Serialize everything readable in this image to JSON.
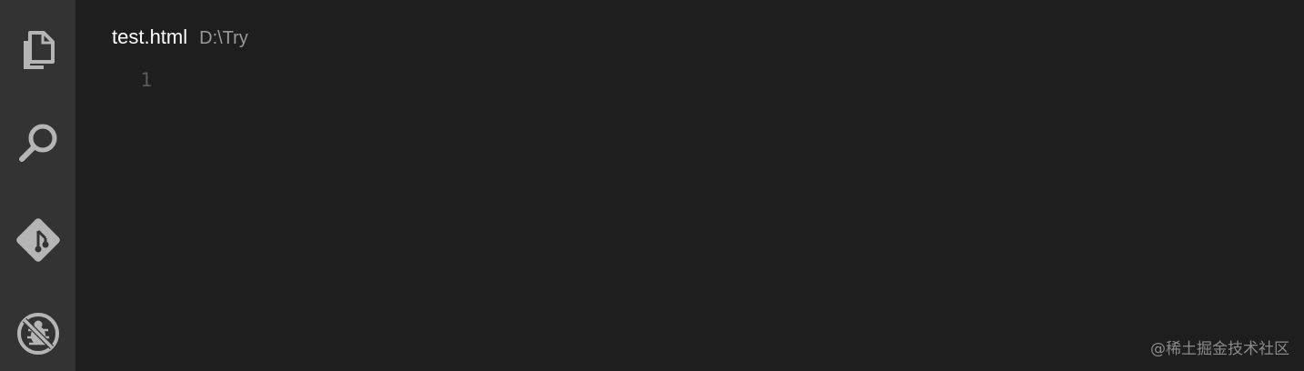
{
  "activity_bar": {
    "items": [
      {
        "icon": "files-icon"
      },
      {
        "icon": "search-icon"
      },
      {
        "icon": "git-icon"
      },
      {
        "icon": "debug-icon"
      }
    ]
  },
  "editor": {
    "file_name": "test.html",
    "file_path": "D:\\Try",
    "lines": [
      {
        "number": "1",
        "text": ""
      }
    ]
  },
  "watermark": "@稀土掘金技术社区",
  "colors": {
    "activity_bar_bg": "#333333",
    "editor_bg": "#1e1e1e",
    "icon": "#b5b5b5",
    "line_number": "#5a5a5a"
  }
}
